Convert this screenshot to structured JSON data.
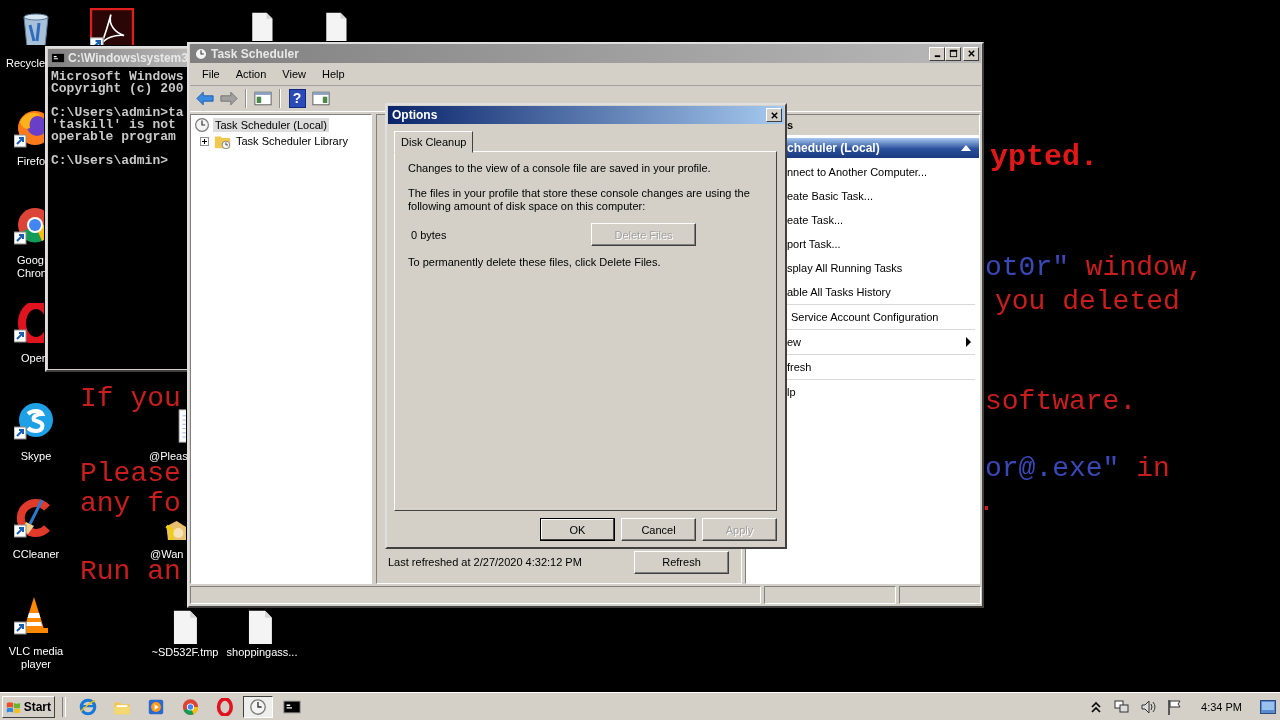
{
  "desktop_icons": [
    {
      "kind": "recycle",
      "label": "Recycle",
      "shortcut": false
    },
    {
      "kind": "pdf",
      "shortcut": true
    },
    {
      "kind": "file",
      "shortcut": false
    },
    {
      "kind": "file",
      "shortcut": false
    },
    {
      "kind": "firefox",
      "label": "Firefo",
      "shortcut": true
    },
    {
      "kind": "chrome",
      "label": "Goog Chron",
      "shortcut": true
    },
    {
      "kind": "opera",
      "label": "Oper",
      "shortcut": true
    },
    {
      "kind": "skype",
      "label": "Skype",
      "shortcut": true
    },
    {
      "kind": "ccleaner",
      "label": "CCleaner",
      "shortcut": true
    },
    {
      "kind": "vlc",
      "label": "VLC media player",
      "shortcut": true
    },
    {
      "kind": "note",
      "label": "@Pleas",
      "shortcut": false
    },
    {
      "kind": "wallet",
      "label": "@Wan",
      "shortcut": false
    },
    {
      "kind": "file",
      "label": "~SD532F.tmp",
      "shortcut": false
    },
    {
      "kind": "file",
      "label": "shoppingass...",
      "shortcut": false
    }
  ],
  "wallpaper_text": [
    {
      "emphasis": false,
      "segments": [
        {
          "text": "If you",
          "color": "#c81e1e"
        }
      ]
    },
    {
      "emphasis": false,
      "segments": [
        {
          "text": "Please",
          "color": "#c81e1e"
        }
      ]
    },
    {
      "emphasis": false,
      "segments": [
        {
          "text": "any fo",
          "color": "#c81e1e"
        }
      ]
    },
    {
      "emphasis": false,
      "segments": [
        {
          "text": "Run an",
          "color": "#c81e1e"
        }
      ]
    },
    {
      "emphasis": true,
      "segments": [
        {
          "text": "ypted.",
          "color": "#e01818"
        }
      ]
    },
    {
      "emphasis": false,
      "segments": [
        {
          "text": "ot0r\"",
          "color": "#3a48b8"
        },
        {
          "text": " window,",
          "color": "#c81e1e"
        }
      ]
    },
    {
      "emphasis": false,
      "segments": [
        {
          "text": "you deleted",
          "color": "#c81e1e"
        }
      ]
    },
    {
      "emphasis": false,
      "segments": [
        {
          "text": "software.",
          "color": "#c81e1e"
        }
      ]
    },
    {
      "emphasis": false,
      "segments": [
        {
          "text": "or@.exe\"",
          "color": "#3a48b8"
        },
        {
          "text": " in",
          "color": "#c81e1e"
        }
      ]
    },
    {
      "emphasis": false,
      "segments": [
        {
          "text": ".",
          "color": "#c81e1e"
        }
      ]
    }
  ],
  "console": {
    "title": "C:\\Windows\\system3",
    "blocks": [
      [
        "Microsoft Windows",
        "Copyright (c) 200"
      ],
      [
        "C:\\Users\\admin>ta",
        "'taskill' is not",
        "operable program"
      ],
      [
        "C:\\Users\\admin>"
      ]
    ]
  },
  "task_scheduler": {
    "title": "Task Scheduler",
    "menu": [
      "File",
      "Action",
      "View",
      "Help"
    ],
    "toolbar": [
      {
        "kind": "back"
      },
      {
        "kind": "forward"
      },
      {
        "kind": "pane"
      },
      {
        "kind": "help",
        "glyph": "?"
      },
      {
        "kind": "pane2"
      }
    ],
    "tree": [
      {
        "label": "Task Scheduler (Local)",
        "selected": true,
        "children": [
          {
            "label": "Task Scheduler Library",
            "selected": false,
            "expanded": false
          }
        ]
      }
    ],
    "middle": {
      "status_text": "Last refreshed at 2/27/2020 4:32:12 PM",
      "refresh_button": "Refresh"
    },
    "actions": {
      "title": "s",
      "section": "cheduler (Local)",
      "groups": [
        [
          {
            "label": "nnect to Another Computer...",
            "kind": "item"
          },
          {
            "label": "eate Basic Task...",
            "kind": "item"
          },
          {
            "label": "eate Task...",
            "kind": "item"
          },
          {
            "label": "port Task...",
            "kind": "item"
          },
          {
            "label": "splay All Running Tasks",
            "kind": "item"
          },
          {
            "label": "able All Tasks History",
            "kind": "item"
          }
        ],
        [
          {
            "label": "Service Account Configuration",
            "kind": "item"
          }
        ],
        [
          {
            "label": "ew",
            "kind": "submenu"
          }
        ],
        [
          {
            "label": "fresh",
            "kind": "item"
          }
        ],
        [
          {
            "label": "lp",
            "kind": "item"
          }
        ]
      ]
    }
  },
  "options_dialog": {
    "title": "Options",
    "tabs": [
      {
        "label": "Disk Cleanup",
        "selected": true
      }
    ],
    "paragraphs": [
      "Changes to the view of a console file are saved in your profile.",
      "The files in your profile that store these console changes are using the following amount of disk space on this computer:"
    ],
    "size": "0 bytes",
    "delete_button": {
      "label": "Delete Files",
      "disabled": true
    },
    "footer": "To permanently delete these files, click Delete Files.",
    "buttons": [
      {
        "label": "OK",
        "disabled": false,
        "default": true
      },
      {
        "label": "Cancel",
        "disabled": false,
        "default": false
      },
      {
        "label": "Apply",
        "disabled": true,
        "default": false
      }
    ]
  },
  "taskbar": {
    "start": "Start",
    "items": [
      {
        "kind": "ie",
        "selected": false
      },
      {
        "kind": "folder",
        "selected": false
      },
      {
        "kind": "media",
        "selected": false
      },
      {
        "kind": "chrome",
        "selected": false
      },
      {
        "kind": "opera",
        "selected": false
      },
      {
        "kind": "clock",
        "selected": true
      },
      {
        "kind": "cmd",
        "selected": false
      }
    ],
    "clock": "4:34 PM"
  }
}
